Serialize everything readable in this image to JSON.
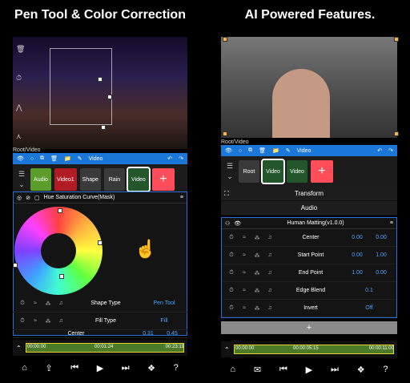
{
  "left": {
    "headline": "Pen Tool & Color Correction",
    "breadcrumb": "Root/Video",
    "toolbar": {
      "video_label": "Video"
    },
    "layers": [
      {
        "label": "Audio",
        "color": "#5b9c2b"
      },
      {
        "label": "Video1",
        "color": "#b01b24"
      },
      {
        "label": "Shape",
        "color": "#4b4b4b"
      },
      {
        "label": "Rain",
        "color": "#4b4b4b"
      },
      {
        "label": "Video",
        "color": "#23562a"
      }
    ],
    "effect_panel": {
      "title": "Hue Saturation Curve(Mask)",
      "rows": [
        {
          "label": "Shape Type",
          "value": "Pen Tool"
        },
        {
          "label": "Fill Type",
          "value": "Fill"
        },
        {
          "label": "Center",
          "value1": "0.31",
          "value2": "0.45"
        }
      ]
    },
    "timeline": {
      "start": "00:00:00",
      "current": "00:01:24",
      "end": "00:23:19"
    }
  },
  "right": {
    "headline": "AI Powered Features.",
    "breadcrumb": "Root/Video",
    "toolbar": {
      "video_label": "Video"
    },
    "layers": [
      {
        "label": "Root",
        "color": "#3a3a3a"
      },
      {
        "label": "Video",
        "color": "#23562a"
      },
      {
        "label": "Video",
        "color": "#23562a"
      }
    ],
    "sections": [
      "Transform",
      "Audio"
    ],
    "effect_panel": {
      "title": "Human Matting(v1.0.0)",
      "rows": [
        {
          "label": "Center",
          "value1": "0.00",
          "value2": "0.00"
        },
        {
          "label": "Start Point",
          "value1": "0.00",
          "value2": "1.00"
        },
        {
          "label": "End Point",
          "value1": "1.00",
          "value2": "0.00"
        },
        {
          "label": "Edge Blend",
          "value1": "0.1"
        },
        {
          "label": "Invert",
          "value1": "Off"
        }
      ]
    },
    "timeline": {
      "start": "00:00:00",
      "current": "00:00:05:15",
      "end": "00:00:11:00"
    }
  },
  "colors": {
    "accent": "#1c78d8",
    "add": "#ff4d5a",
    "value": "#4ba3ff"
  }
}
